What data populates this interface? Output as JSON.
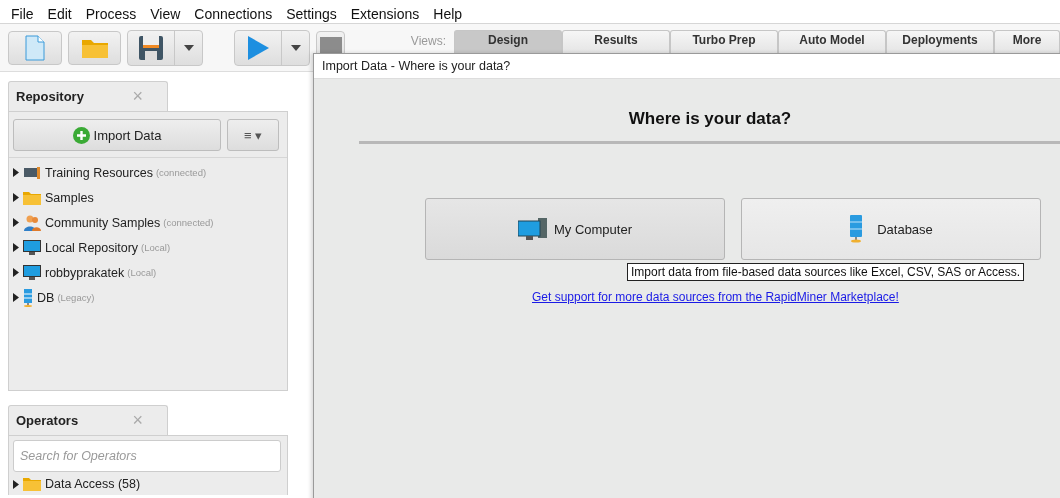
{
  "menu": [
    {
      "label": "File"
    },
    {
      "label": "Edit"
    },
    {
      "label": "Process"
    },
    {
      "label": "View"
    },
    {
      "label": "Connections"
    },
    {
      "label": "Settings"
    },
    {
      "label": "Extensions"
    },
    {
      "label": "Help"
    }
  ],
  "toolbar": {
    "buttons": [
      {
        "kind": "new"
      },
      {
        "kind": "open"
      },
      {
        "kind": "save",
        "dropdown": true
      },
      {
        "kind": "run",
        "dropdown": true
      },
      {
        "kind": "stop"
      }
    ],
    "views_label": "Views:",
    "views": [
      {
        "label": "Design",
        "selected": true
      },
      {
        "label": "Results",
        "selected": false
      },
      {
        "label": "Turbo Prep",
        "selected": false
      },
      {
        "label": "Auto Model",
        "selected": false
      },
      {
        "label": "Deployments",
        "selected": false
      },
      {
        "label": "More",
        "selected": false
      }
    ]
  },
  "repository": {
    "title": "Repository",
    "close": "×",
    "import_button": "Import Data",
    "menu_button": "≡ ▾",
    "items": [
      {
        "kind": "training",
        "label": "Training Resources",
        "note": "(connected)"
      },
      {
        "kind": "folder",
        "label": "Samples"
      },
      {
        "kind": "community",
        "label": "Community Samples",
        "note": "(connected)"
      },
      {
        "kind": "computer",
        "label": "Local Repository",
        "note": "(Local)"
      },
      {
        "kind": "computer",
        "label": "robbyprakatek",
        "note": "(Local)"
      },
      {
        "kind": "database",
        "label": "DB",
        "note": "(Legacy)"
      }
    ]
  },
  "operators": {
    "title": "Operators",
    "close": "×",
    "search": {
      "placeholder": "Search for Operators"
    },
    "items": [
      {
        "kind": "folder",
        "label": "Data Access (58)"
      }
    ]
  },
  "dialog": {
    "title": "Import Data - Where is your data?",
    "heading": "Where is your data?",
    "sources": [
      {
        "kind": "computer",
        "label": "My Computer"
      },
      {
        "kind": "database",
        "label": "Database"
      }
    ],
    "tooltip": "Import data from file-based data sources like Excel, CSV, SAS or Access.",
    "link": "Get support for more data sources from the RapidMiner Marketplace!"
  }
}
